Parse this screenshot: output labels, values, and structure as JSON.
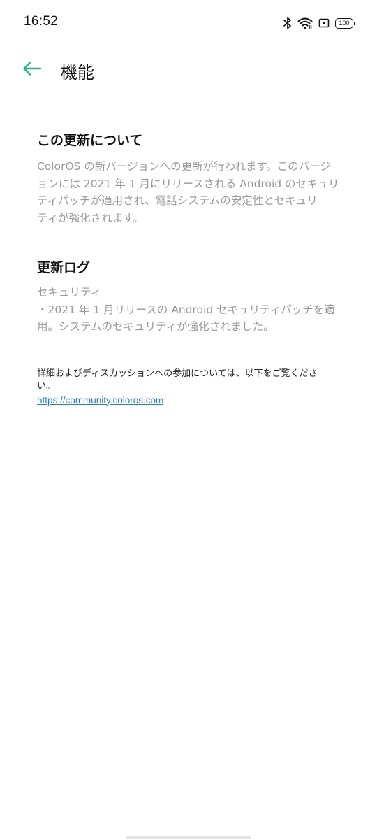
{
  "status_bar": {
    "time": "16:52",
    "battery_level": "100",
    "icons": [
      "bluetooth-icon",
      "wifi-icon",
      "sim-card-icon",
      "battery-icon"
    ]
  },
  "toolbar": {
    "back_icon": "arrow-left-icon",
    "title": "機能",
    "accent_color": "#2bb08a"
  },
  "about_update": {
    "heading": "この更新について",
    "body": "ColorOS の新バージョンへの更新が行われます。このバージ\nョンには 2021 年 1 月にリリースされる Android のセキュリ\nティパッチが適用され、電話システムの安定性とセキュリ\nティが強化されます。"
  },
  "update_log": {
    "heading": "更新ログ",
    "category": "セキュリティ",
    "item": "・2021 年 1 月リリースの Android セキュリティパッチを適\n用。システムのセキュリティが強化されました。"
  },
  "footer": {
    "note": "詳細およびディスカッションへの参加については、以下をご覧くださ\nい。",
    "link_text": "https://community.coloros.com"
  }
}
